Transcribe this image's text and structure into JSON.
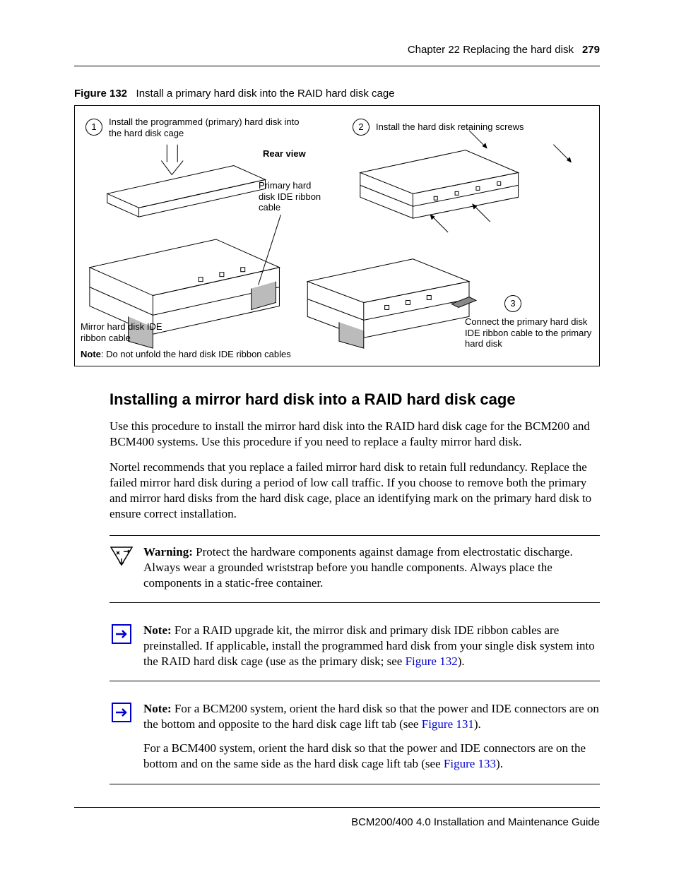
{
  "header": {
    "chapter": "Chapter 22  Replacing the hard disk",
    "page": "279"
  },
  "figure": {
    "label": "Figure 132",
    "caption": "Install a primary hard disk into the RAID hard disk cage",
    "step1_num": "1",
    "step1": "Install the programmed (primary) hard disk into the hard disk cage",
    "step2_num": "2",
    "step2": "Install the hard disk retaining screws",
    "step3_num": "3",
    "step3": "Connect the primary hard disk IDE ribbon cable to the primary hard disk",
    "rear_view": "Rear view",
    "primary_cable": "Primary hard disk IDE ribbon cable",
    "mirror_cable": "Mirror hard disk IDE ribbon cable",
    "note_b": "Note",
    "note": ": Do not unfold the hard disk IDE ribbon cables"
  },
  "section": {
    "heading": "Installing a mirror hard disk into a RAID hard disk cage",
    "p1": "Use this procedure to install the mirror hard disk into the RAID hard disk cage for the BCM200 and BCM400 systems. Use this procedure if you need to replace a faulty mirror hard disk.",
    "p2": "Nortel recommends that you replace a failed mirror hard disk to retain full redundancy. Replace the failed mirror hard disk during a period of low call traffic. If you choose to remove both the primary and mirror hard disks from the hard disk cage, place an identifying mark on the primary hard disk to ensure correct installation."
  },
  "warning": {
    "b": "Warning:",
    "text": " Protect the hardware components against damage from electrostatic discharge. Always wear a grounded wriststrap before you handle components. Always place the components in a static-free container."
  },
  "note1": {
    "b": "Note:",
    "text_a": " For a RAID upgrade kit, the mirror disk and primary disk IDE ribbon cables are preinstalled. If applicable, install the programmed hard disk from your single disk system into the RAID hard disk cage (use as the primary disk; see ",
    "link": "Figure 132",
    "text_b": ")."
  },
  "note2": {
    "b": "Note:",
    "p1a": " For a BCM200 system, orient the hard disk so that the power and IDE connectors are on the bottom and opposite to the hard disk cage lift tab (see ",
    "p1link": "Figure 131",
    "p1b": ").",
    "p2a": "For a BCM400 system, orient the hard disk so that the power and IDE connectors are on the bottom and on the same side as the hard disk cage lift tab (see ",
    "p2link": "Figure 133",
    "p2b": ")."
  },
  "footer": "BCM200/400 4.0 Installation and Maintenance Guide"
}
